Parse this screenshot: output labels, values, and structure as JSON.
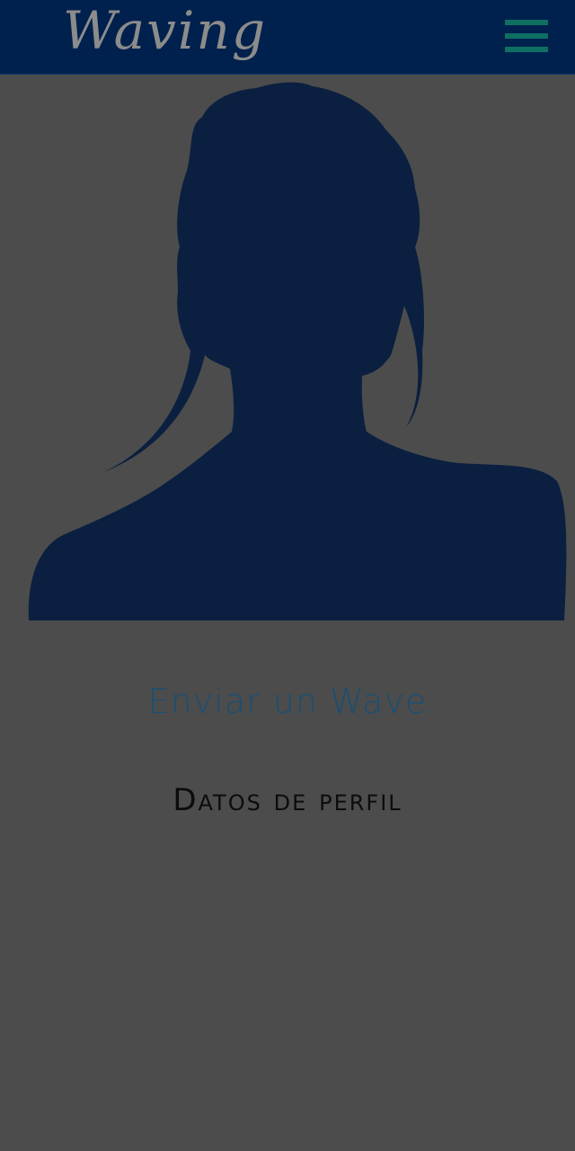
{
  "header": {
    "logo_text": "Waving",
    "menu_icon": "hamburger-menu-icon",
    "background_color": "#00214d",
    "menu_color": "#0f6f63"
  },
  "profile": {
    "avatar_icon": "female-silhouette-avatar",
    "avatar_color": "#0b2040",
    "send_wave_label": "Enviar un Wave",
    "profile_data_heading": "Datos de perfil"
  },
  "colors": {
    "overlay_background": "#4c4c4c",
    "link_color": "#1b4f72"
  }
}
